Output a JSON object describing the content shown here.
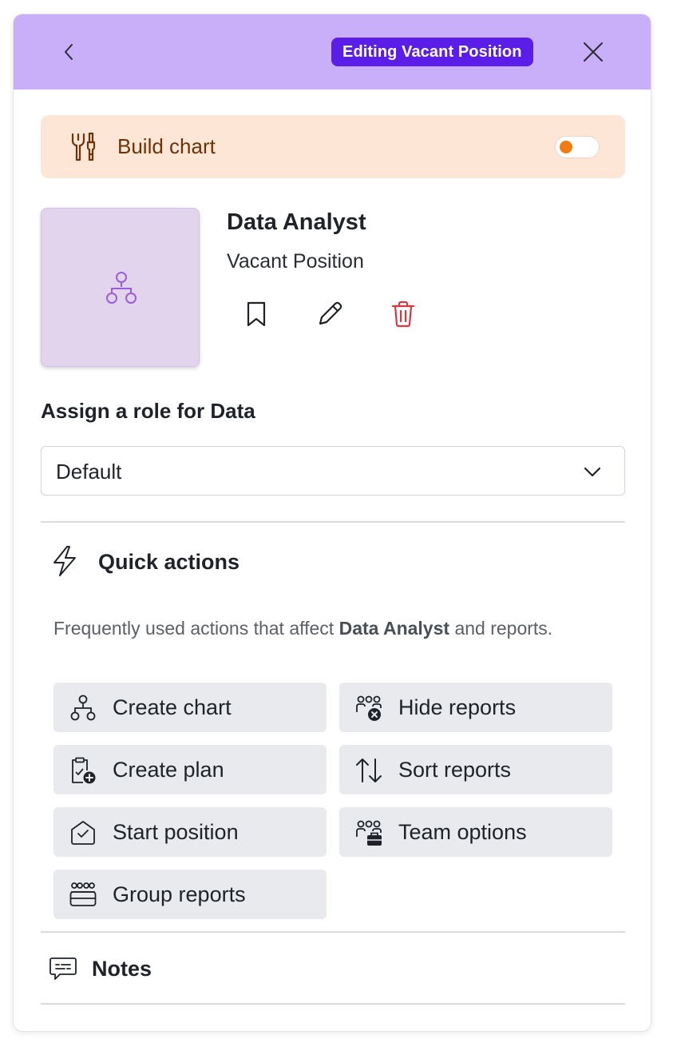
{
  "header": {
    "badge": "Editing Vacant Position",
    "background": "#c9aefa",
    "badge_color": "#5b1ee8",
    "back_icon": "chevron-left-icon",
    "close_icon": "close-icon"
  },
  "build_chart": {
    "label": "Build chart",
    "icon": "tools-icon",
    "toggle_on": false,
    "background": "#fde6d5",
    "accent": "#f07c12"
  },
  "position": {
    "title": "Data Analyst",
    "subtitle": "Vacant Position",
    "avatar_icon": "org-chart-icon",
    "actions": [
      "bookmark-icon",
      "pencil-icon",
      "trash-icon"
    ],
    "delete_color": "#d9363e"
  },
  "role": {
    "label": "Assign a role for Data",
    "selected": "Default"
  },
  "quick_actions": {
    "title": "Quick actions",
    "description_prefix": "Frequently used actions that affect ",
    "description_bold": "Data Analyst",
    "description_suffix": " and reports.",
    "buttons": [
      {
        "label": "Create chart",
        "icon": "org-chart-icon"
      },
      {
        "label": "Hide reports",
        "icon": "people-hide-icon"
      },
      {
        "label": "Create plan",
        "icon": "clipboard-add-icon"
      },
      {
        "label": "Sort reports",
        "icon": "sort-arrows-icon"
      },
      {
        "label": "Start position",
        "icon": "house-check-icon"
      },
      {
        "label": "Team options",
        "icon": "people-briefcase-icon"
      },
      {
        "label": "Group reports",
        "icon": "people-group-icon"
      }
    ]
  },
  "notes": {
    "label": "Notes",
    "icon": "comment-icon"
  }
}
